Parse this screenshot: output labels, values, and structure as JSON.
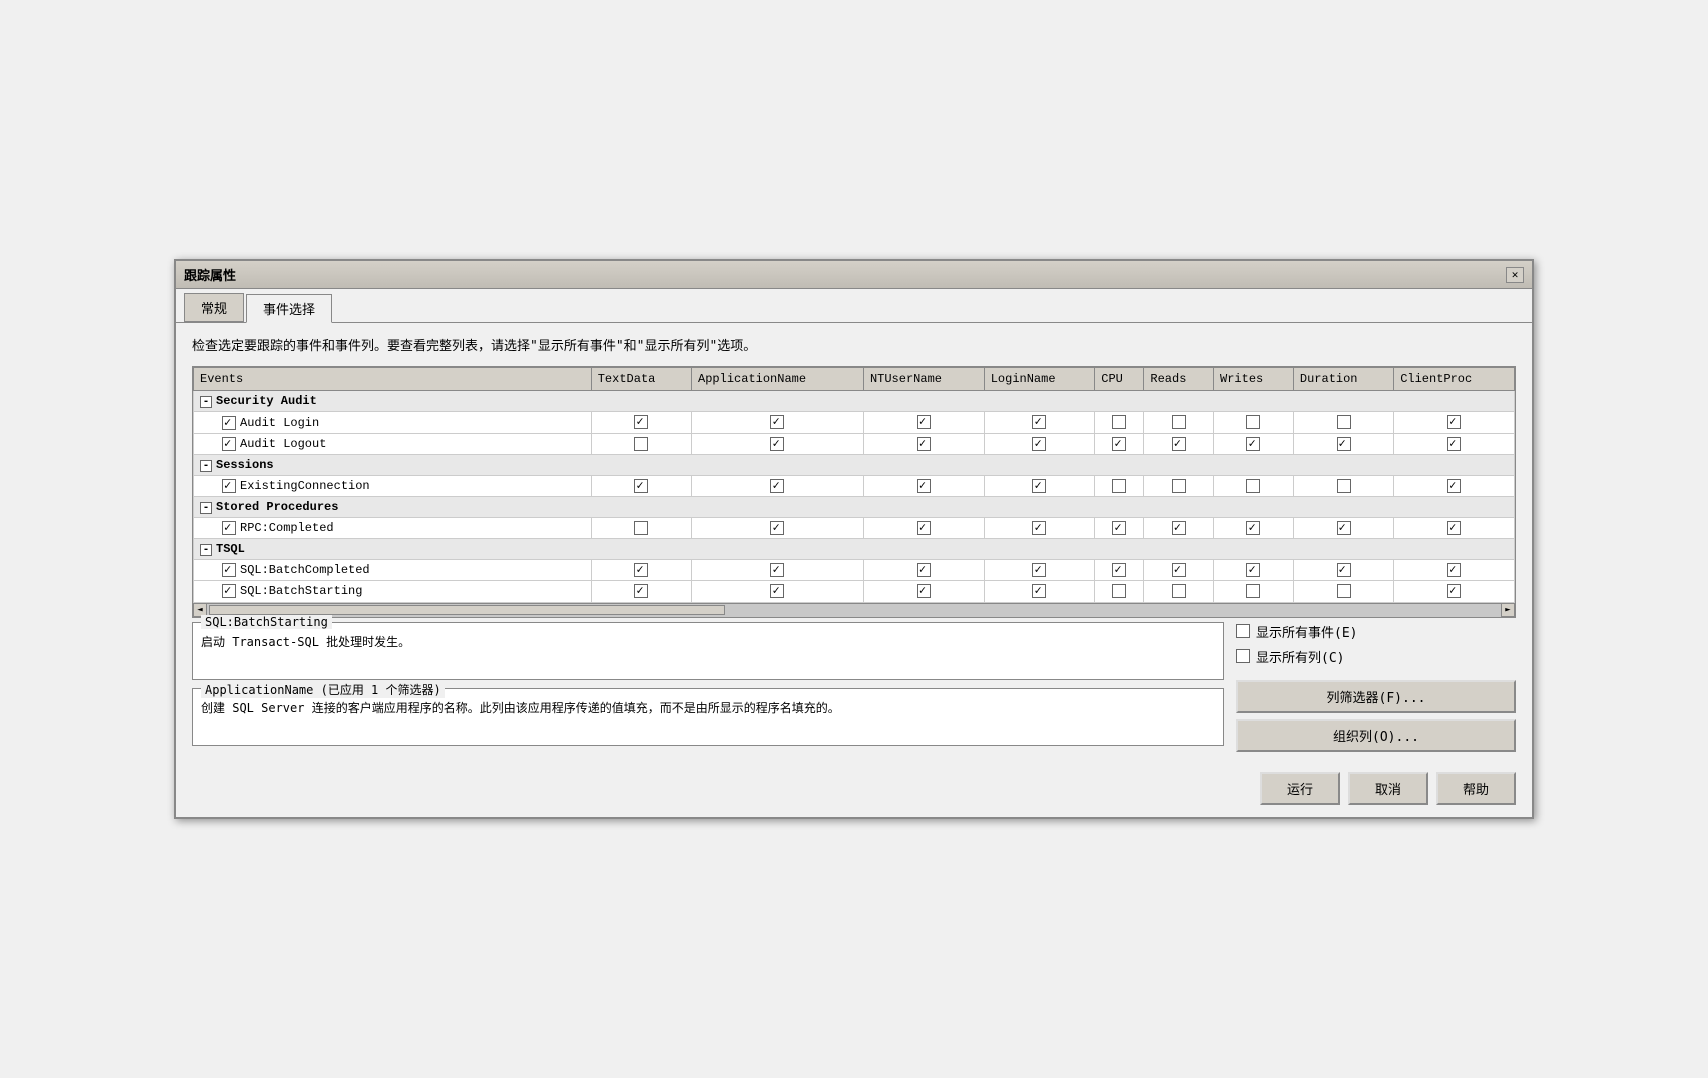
{
  "window": {
    "title": "跟踪属性",
    "close_label": "✕"
  },
  "tabs": [
    {
      "id": "general",
      "label": "常规",
      "active": false
    },
    {
      "id": "events",
      "label": "事件选择",
      "active": true
    }
  ],
  "description": "检查选定要跟踪的事件和事件列。要查看完整列表，请选择\"显示所有事件\"和\"显示所有列\"选项。",
  "table": {
    "columns": [
      "Events",
      "TextData",
      "ApplicationName",
      "NTUserName",
      "LoginName",
      "CPU",
      "Reads",
      "Writes",
      "Duration",
      "ClientProc"
    ],
    "groups": [
      {
        "name": "Security Audit",
        "collapsed": false,
        "items": [
          {
            "name": "Audit Login",
            "checked": true,
            "cols": {
              "TextData": true,
              "ApplicationName": true,
              "NTUserName": true,
              "LoginName": true,
              "CPU": false,
              "Reads": false,
              "Writes": false,
              "Duration": false,
              "ClientProc": true
            }
          },
          {
            "name": "Audit Logout",
            "checked": true,
            "cols": {
              "TextData": false,
              "ApplicationName": true,
              "NTUserName": true,
              "LoginName": true,
              "CPU": true,
              "Reads": true,
              "Writes": true,
              "Duration": true,
              "ClientProc": true
            }
          }
        ]
      },
      {
        "name": "Sessions",
        "collapsed": false,
        "items": [
          {
            "name": "ExistingConnection",
            "checked": true,
            "cols": {
              "TextData": true,
              "ApplicationName": true,
              "NTUserName": true,
              "LoginName": true,
              "CPU": false,
              "Reads": false,
              "Writes": false,
              "Duration": false,
              "ClientProc": true
            }
          }
        ]
      },
      {
        "name": "Stored Procedures",
        "collapsed": false,
        "items": [
          {
            "name": "RPC:Completed",
            "checked": true,
            "cols": {
              "TextData": false,
              "ApplicationName": true,
              "NTUserName": true,
              "LoginName": true,
              "CPU": true,
              "Reads": true,
              "Writes": true,
              "Duration": true,
              "ClientProc": true
            }
          }
        ]
      },
      {
        "name": "TSQL",
        "collapsed": false,
        "items": [
          {
            "name": "SQL:BatchCompleted",
            "checked": true,
            "cols": {
              "TextData": true,
              "ApplicationName": true,
              "NTUserName": true,
              "LoginName": true,
              "CPU": true,
              "Reads": true,
              "Writes": true,
              "Duration": true,
              "ClientProc": true
            }
          },
          {
            "name": "SQL:BatchStarting",
            "checked": true,
            "cols": {
              "TextData": true,
              "ApplicationName": true,
              "NTUserName": true,
              "LoginName": true,
              "CPU": false,
              "Reads": false,
              "Writes": false,
              "Duration": false,
              "ClientProc": true
            }
          }
        ]
      }
    ]
  },
  "event_info": {
    "title": "SQL:BatchStarting",
    "content": "启动 Transact-SQL 批处理时发生。"
  },
  "appname_info": {
    "title": "ApplicationName (已应用 1 个筛选器)",
    "content": "创建 SQL Server 连接的客户端应用程序的名称。此列由该应用程序传递的值填充，而不是由所显示的程序名填充的。"
  },
  "options": {
    "show_all_events": {
      "label": "显示所有事件(E)",
      "checked": false
    },
    "show_all_columns": {
      "label": "显示所有列(C)",
      "checked": false
    }
  },
  "buttons": {
    "column_filter": "列筛选器(F)...",
    "organize_columns": "组织列(O)..."
  },
  "footer": {
    "run": "运行",
    "cancel": "取消",
    "help": "帮助"
  }
}
